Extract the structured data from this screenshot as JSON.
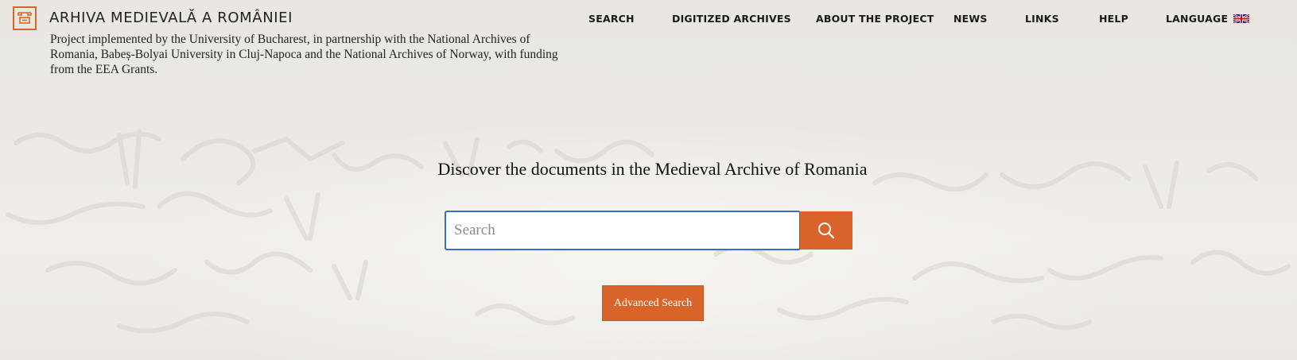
{
  "header": {
    "site_title": "ARHIVA MEDIEVALĂ A ROMÂNIEI",
    "description": "Project implemented by the University of Bucharest, in partnership with the National Archives of Romania, Babeș-Bolyai University in Cluj-Napoca and the National Archives of Norway, with funding from the EEA Grants.",
    "logo_icon": "archive-gate-logo-icon",
    "accent_color": "#d9642a"
  },
  "nav": {
    "items": [
      {
        "label": "SEARCH"
      },
      {
        "label": "DIGITIZED ARCHIVES"
      },
      {
        "label": "ABOUT THE PROJECT"
      },
      {
        "label": "NEWS"
      },
      {
        "label": "LINKS"
      },
      {
        "label": "HELP"
      },
      {
        "label": "LANGUAGE"
      }
    ],
    "language_flag_icon": "uk-flag-icon"
  },
  "hero": {
    "heading": "Discover the documents in the Medieval Archive of Romania",
    "search": {
      "placeholder": "Search",
      "value": "",
      "button_icon": "search-icon",
      "focus_color": "#2f6fd0"
    },
    "advanced_search_label": "Advanced Search"
  }
}
